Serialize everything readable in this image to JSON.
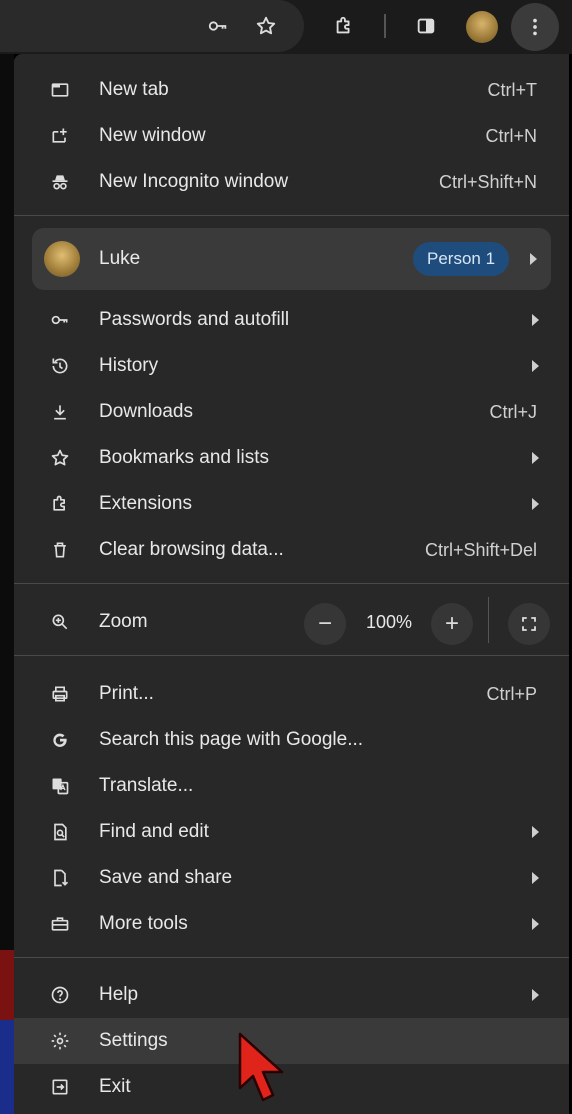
{
  "toolbar": {
    "icons": [
      "key-icon",
      "star-icon",
      "extensions-icon",
      "side-panel-icon",
      "profile-avatar",
      "more-menu-icon"
    ]
  },
  "menu": {
    "section1": [
      {
        "label": "New tab",
        "shortcut": "Ctrl+T",
        "icon": "new-tab-icon"
      },
      {
        "label": "New window",
        "shortcut": "Ctrl+N",
        "icon": "new-window-icon"
      },
      {
        "label": "New Incognito window",
        "shortcut": "Ctrl+Shift+N",
        "icon": "incognito-icon"
      }
    ],
    "profile": {
      "name": "Luke",
      "badge": "Person 1"
    },
    "section2": [
      {
        "label": "Passwords and autofill",
        "icon": "key-icon",
        "submenu": true
      },
      {
        "label": "History",
        "icon": "history-icon",
        "submenu": true
      },
      {
        "label": "Downloads",
        "shortcut": "Ctrl+J",
        "icon": "download-icon"
      },
      {
        "label": "Bookmarks and lists",
        "icon": "star-icon",
        "submenu": true
      },
      {
        "label": "Extensions",
        "icon": "extensions-icon",
        "submenu": true
      },
      {
        "label": "Clear browsing data...",
        "shortcut": "Ctrl+Shift+Del",
        "icon": "trash-icon"
      }
    ],
    "zoom": {
      "label": "Zoom",
      "minus": "−",
      "value": "100%",
      "plus": "+"
    },
    "section3": [
      {
        "label": "Print...",
        "shortcut": "Ctrl+P",
        "icon": "print-icon"
      },
      {
        "label": "Search this page with Google...",
        "icon": "google-icon"
      },
      {
        "label": "Translate...",
        "icon": "translate-icon"
      },
      {
        "label": "Find and edit",
        "icon": "find-icon",
        "submenu": true
      },
      {
        "label": "Save and share",
        "icon": "save-share-icon",
        "submenu": true
      },
      {
        "label": "More tools",
        "icon": "toolbox-icon",
        "submenu": true
      }
    ],
    "section4": [
      {
        "label": "Help",
        "icon": "help-icon",
        "submenu": true
      },
      {
        "label": "Settings",
        "icon": "gear-icon",
        "highlighted": true
      },
      {
        "label": "Exit",
        "icon": "exit-icon"
      }
    ]
  },
  "colors": {
    "menu_bg": "#282828",
    "highlight_bg": "#3a3a3a",
    "badge_bg": "#1e4d7d",
    "cursor": "#e0241b"
  }
}
